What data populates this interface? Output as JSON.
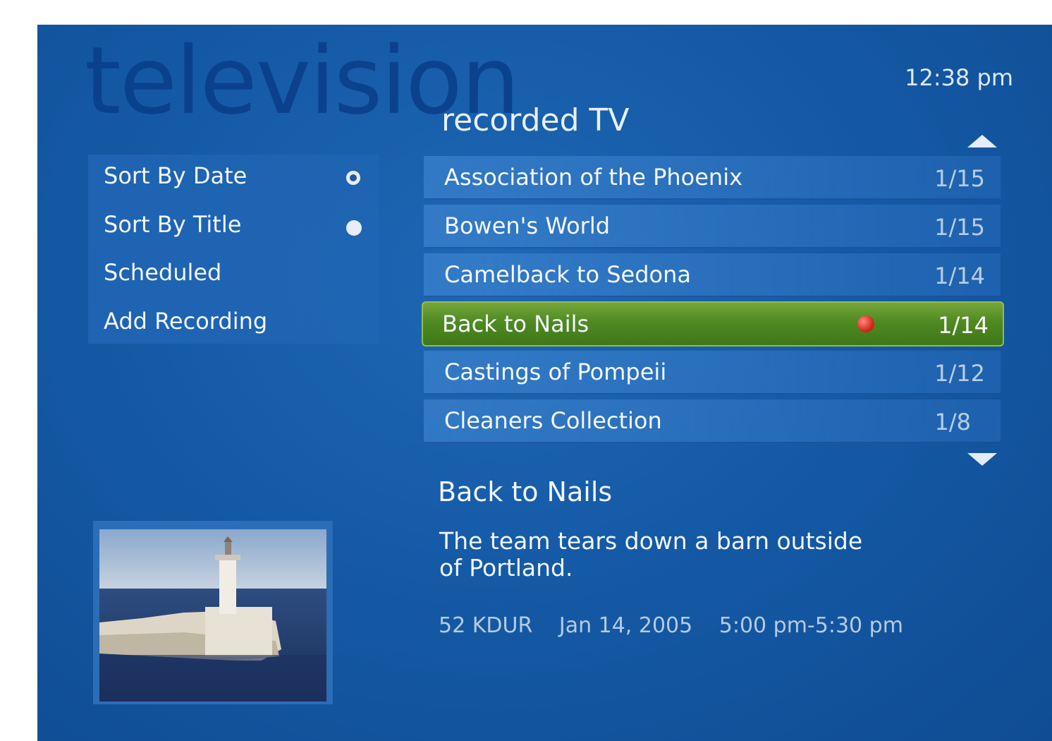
{
  "page": {
    "watermark": "television",
    "clock": "12:38 pm",
    "section_title": "recorded TV"
  },
  "menu": {
    "items": [
      {
        "label": "Sort By Date"
      },
      {
        "label": "Sort By Title"
      },
      {
        "label": "Scheduled"
      },
      {
        "label": "Add Recording"
      }
    ]
  },
  "recordings": {
    "rows": [
      {
        "title": "Association of the Phoenix",
        "date": "1/15"
      },
      {
        "title": "Bowen's World",
        "date": "1/15"
      },
      {
        "title": "Camelback to Sedona",
        "date": "1/14"
      },
      {
        "title": "Back to Nails",
        "date": "1/14",
        "selected": true
      },
      {
        "title": "Castings of Pompeii",
        "date": "1/12"
      },
      {
        "title": "Cleaners Collection",
        "date": "1/8"
      }
    ]
  },
  "details": {
    "title": "Back to Nails",
    "description": "The team tears down a barn outside of Portland.",
    "channel": "52 KDUR",
    "date": "Jan 14, 2005",
    "time": "5:00 pm-5:30 pm"
  },
  "icons": {
    "scroll_up": "triangle-up-icon",
    "scroll_down": "triangle-down-icon",
    "recording": "red-dot-icon"
  },
  "colors": {
    "background": "#155aa6",
    "selected_row": "#4f8a22",
    "recording_dot": "#d42a1c"
  }
}
